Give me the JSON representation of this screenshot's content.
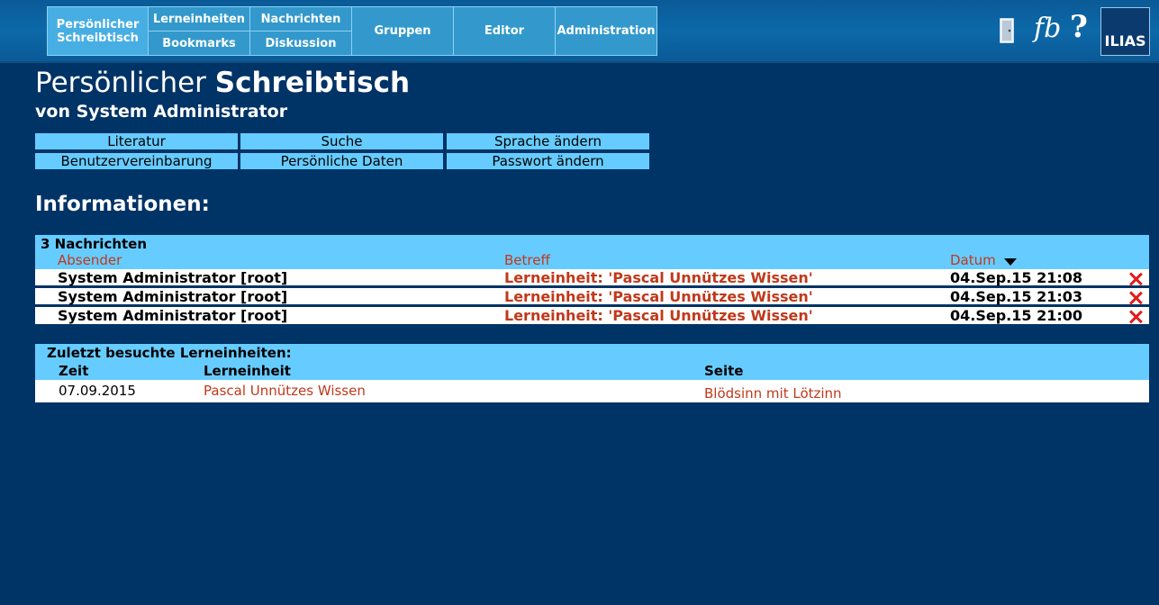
{
  "nav": {
    "desk_line1": "Persönlicher",
    "desk_line2": "Schreibtisch",
    "lerneinheiten": "Lerneinheiten",
    "bookmarks": "Bookmarks",
    "nachrichten": "Nachrichten",
    "diskussion": "Diskussion",
    "gruppen": "Gruppen",
    "editor": "Editor",
    "administration": "Administration"
  },
  "icons": {
    "logout": "door-icon",
    "fb": "fb",
    "help": "?"
  },
  "logo": "ILIAS",
  "page": {
    "title_light": "Persönlicher",
    "title_bold": "Schreibtisch",
    "subtitle": "von System Administrator"
  },
  "buttons": [
    "Literatur",
    "Suche",
    "Sprache ändern",
    "Benutzervereinbarung",
    "Persönliche Daten",
    "Passwort ändern"
  ],
  "section_title": "Informationen:",
  "messages": {
    "title": "3 Nachrichten",
    "col_sender": "Absender",
    "col_subject": "Betreff",
    "col_date": "Datum",
    "rows": [
      {
        "sender": "System Administrator [root]",
        "subject": "Lerneinheit: 'Pascal Unnützes Wissen'",
        "date": "04.Sep.15 21:08"
      },
      {
        "sender": "System Administrator [root]",
        "subject": "Lerneinheit: 'Pascal Unnützes Wissen'",
        "date": "04.Sep.15 21:03"
      },
      {
        "sender": "System Administrator [root]",
        "subject": "Lerneinheit: 'Pascal Unnützes Wissen'",
        "date": "04.Sep.15 21:00"
      }
    ]
  },
  "recent": {
    "title": "Zuletzt besuchte Lerneinheiten:",
    "col_time": "Zeit",
    "col_unit": "Lerneinheit",
    "col_page": "Seite",
    "row": {
      "time": "07.09.2015",
      "unit": "Pascal Unnützes Wissen",
      "page": "Blödsinn mit Lötzinn"
    }
  },
  "colors": {
    "background": "#003366",
    "nav_cell": "#3399cc",
    "panel": "#66ccff",
    "link": "#c0391b",
    "delete": "#e01b1b"
  }
}
